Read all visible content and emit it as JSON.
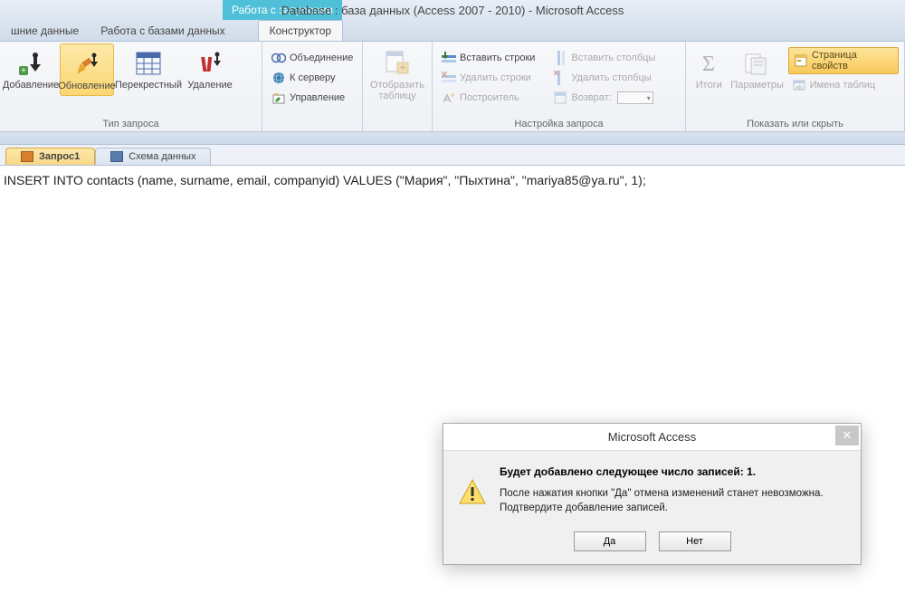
{
  "title": "Database : база данных (Access 2007 - 2010)  -  Microsoft Access",
  "contextual_tab": "Работа с запросами",
  "tabs": {
    "external": "шние данные",
    "dbtools": "Работа с базами данных",
    "designer": "Конструктор"
  },
  "ribbon": {
    "add": "Добавление",
    "update": "Обновление",
    "crosstab": "Перекрестный",
    "delete": "Удаление",
    "group_type": "Тип запроса",
    "union": "Объединение",
    "toserver": "К серверу",
    "manage": "Управление",
    "showtable": "Отобразить таблицу",
    "insert_rows": "Вставить строки",
    "delete_rows": "Удалить строки",
    "builder": "Построитель",
    "insert_cols": "Вставить столбцы",
    "delete_cols": "Удалить столбцы",
    "return": "Возврат:",
    "group_setup": "Настройка запроса",
    "totals": "Итоги",
    "params": "Параметры",
    "prop_page": "Страница свойств",
    "table_names": "Имена таблиц",
    "group_show": "Показать или скрыть"
  },
  "doc_tabs": {
    "query1": "Запрос1",
    "schema": "Схема данных"
  },
  "sql": "INSERT INTO contacts (name, surname, email, companyid) VALUES (\"Мария\", \"Пыхтина\", \"mariya85@ya.ru\", 1);",
  "dialog": {
    "title": "Microsoft Access",
    "bold": "Будет добавлено следующее число записей: 1.",
    "line1": "После нажатия кнопки \"Да\" отмена изменений станет невозможна.",
    "line2": "Подтвердите добавление записей.",
    "yes": "Да",
    "no": "Нет"
  }
}
